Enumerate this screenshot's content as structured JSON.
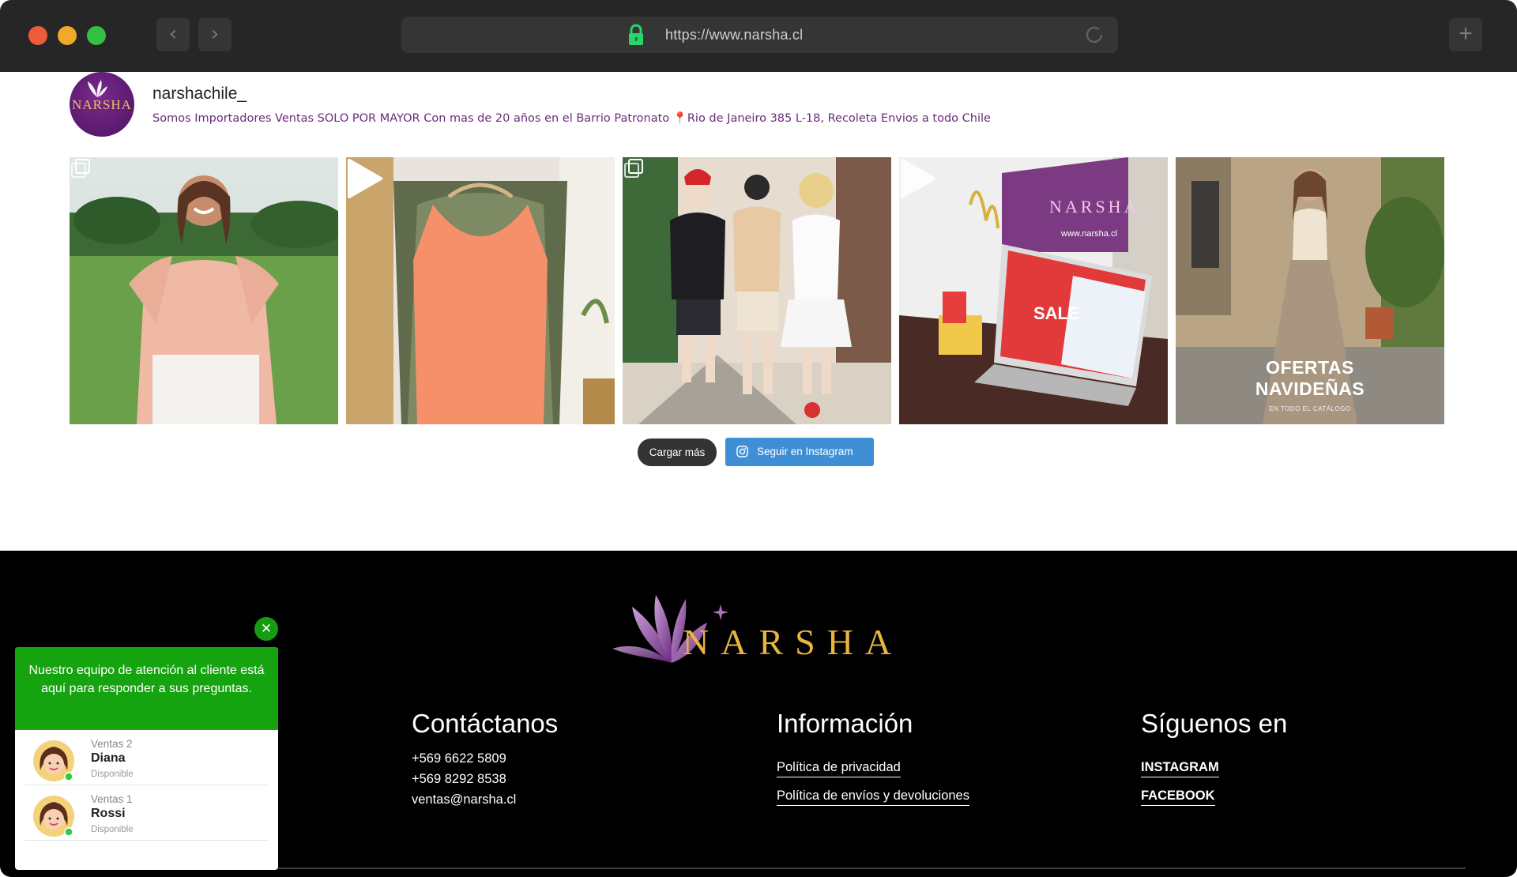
{
  "browser": {
    "url": "https://www.narsha.cl",
    "back_icon": "chevron-left-icon",
    "forward_icon": "chevron-right-icon",
    "new_tab_icon": "plus-icon"
  },
  "profile": {
    "avatar_text": "NARSHA",
    "username": "narshachile_",
    "bio_part1": "Somos Importadores Ventas SOLO POR MAYOR Con mas de 20 años en el Barrio Patronato",
    "bio_part2": "Rio de Janeiro 385 L-18, Recoleta Envios a todo Chile"
  },
  "gallery": {
    "promo_title_line1": "OFERTAS",
    "promo_title_line2": "NAVIDEÑAS",
    "promo_subtitle": "EN TODO EL CATÁLOGO",
    "tile4_sign": "NARSHA",
    "tile4_web": "www.narsha.cl",
    "tile4_sale": "SALE"
  },
  "actions": {
    "load_more": "Cargar más",
    "follow": "Seguir en Instagram"
  },
  "footer": {
    "logo_text": "NARSHA",
    "contact": {
      "title": "Contáctanos",
      "phone1": "+569 6622 5809",
      "phone2": "+569 8292 8538",
      "email": "ventas@narsha.cl"
    },
    "info": {
      "title": "Información",
      "privacy": "Política de privacidad",
      "shipping": "Política de envíos y devoluciones"
    },
    "social": {
      "title": "Síguenos en",
      "instagram": "INSTAGRAM",
      "facebook": "FACEBOOK"
    }
  },
  "chat": {
    "header": "Nuestro equipo de atención al cliente está aquí para responder a sus preguntas.",
    "agents": [
      {
        "dept": "Ventas 2",
        "name": "Diana",
        "status": "Disponible"
      },
      {
        "dept": "Ventas 1",
        "name": "Rossi",
        "status": "Disponible"
      }
    ]
  },
  "colors": {
    "chrome": "#262626",
    "bio": "#6d2a7c",
    "follow_button": "#3f8fd6",
    "chat_green": "#15a40f",
    "logo_gold": "#e9b53d"
  }
}
